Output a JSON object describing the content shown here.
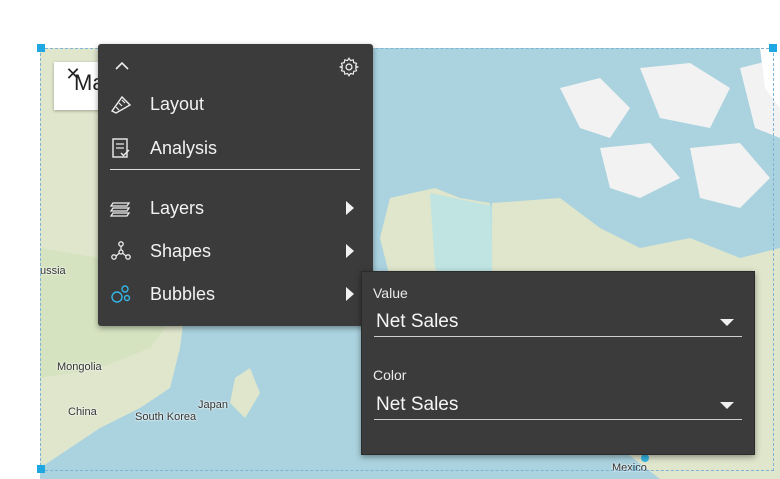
{
  "map": {
    "labels": {
      "russia": "ussia",
      "mongolia": "Mongolia",
      "china": "China",
      "south_korea": "South Korea",
      "japan": "Japan",
      "mexico": "Mexico"
    }
  },
  "title_card": {
    "text": "Ma"
  },
  "menu": {
    "items": [
      {
        "label": "Layout"
      },
      {
        "label": "Analysis"
      },
      {
        "label": "Layers"
      },
      {
        "label": "Shapes"
      },
      {
        "label": "Bubbles"
      }
    ]
  },
  "submenu": {
    "value_label": "Value",
    "value_selected": "Net Sales",
    "color_label": "Color",
    "color_selected": "Net Sales"
  },
  "colors": {
    "menu_bg": "#3b3b3b",
    "accent_icon": "#35b6e6",
    "water": "#aad3df",
    "land": "#dfe6cc"
  }
}
